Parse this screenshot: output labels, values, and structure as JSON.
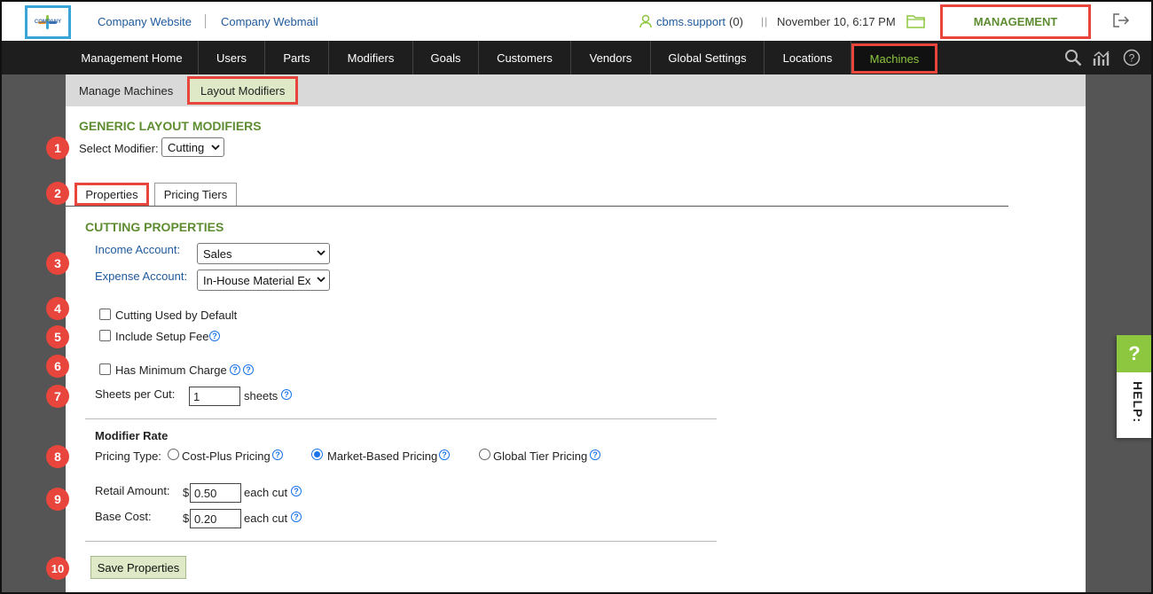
{
  "topbar": {
    "logo_text": "COMPANY",
    "links": [
      "Company Website",
      "Company Webmail"
    ],
    "user": "cbms.support",
    "user_count": "(0)",
    "date": "November 10, 6:17 PM",
    "management": "MANAGEMENT"
  },
  "nav": {
    "items": [
      "Management Home",
      "Users",
      "Parts",
      "Modifiers",
      "Goals",
      "Customers",
      "Vendors",
      "Global Settings",
      "Locations",
      "Machines"
    ],
    "active": "Machines"
  },
  "subnav": {
    "items": [
      "Manage Machines",
      "Layout Modifiers"
    ],
    "active": "Layout Modifiers"
  },
  "page": {
    "title": "GENERIC LAYOUT MODIFIERS",
    "select_modifier_label": "Select Modifier:",
    "select_modifier_value": "Cutting",
    "tabs": [
      "Properties",
      "Pricing Tiers"
    ],
    "section_title": "CUTTING PROPERTIES",
    "income_account_label": "Income Account:",
    "income_account_value": "Sales",
    "expense_account_label": "Expense Account:",
    "expense_account_value": "In-House Material Ex",
    "cb_default": "Cutting Used by Default",
    "cb_setup": "Include Setup Fee",
    "cb_min": "Has Minimum Charge",
    "sheets_label": "Sheets per Cut:",
    "sheets_value": "1",
    "sheets_unit": "sheets",
    "modifier_rate": "Modifier Rate",
    "pricing_type_label": "Pricing Type:",
    "pricing_options": [
      "Cost-Plus Pricing",
      "Market-Based Pricing",
      "Global Tier Pricing"
    ],
    "pricing_selected": "Market-Based Pricing",
    "retail_label": "Retail Amount:",
    "retail_value": "0.50",
    "base_label": "Base Cost:",
    "base_value": "0.20",
    "currency": "$",
    "each_cut": "each cut",
    "save_button": "Save Properties"
  },
  "badges": [
    "1",
    "2",
    "3",
    "4",
    "5",
    "6",
    "7",
    "8",
    "9",
    "10"
  ],
  "help": {
    "mark": "?",
    "text": "HELP:"
  },
  "colors": {
    "accent_green": "#5e8c31",
    "highlight_red": "#e8453c",
    "nav_bg": "#1e1e1e",
    "link_blue": "#1f5a9c"
  }
}
